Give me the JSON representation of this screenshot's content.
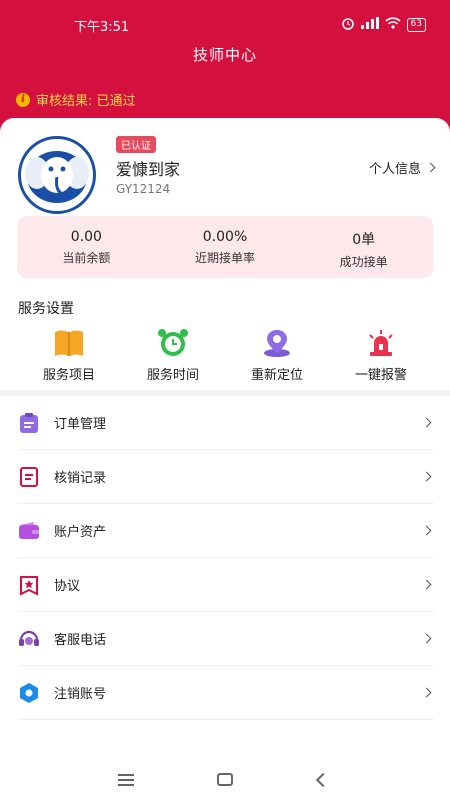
{
  "status_bar": {
    "time": "下午3:51",
    "battery": "63"
  },
  "header": {
    "title": "技师中心"
  },
  "review": {
    "text": "审核结果: 已通过"
  },
  "profile": {
    "badge": "已认证",
    "name": "爱慷到家",
    "id": "GY12124",
    "personal_info_label": "个人信息"
  },
  "stats": [
    {
      "value": "0.00",
      "label": "当前余额"
    },
    {
      "value": "0.00%",
      "label": "近期接单率"
    },
    {
      "value": "0单",
      "label": "成功接单"
    }
  ],
  "services": {
    "title": "服务设置",
    "items": [
      {
        "label": "服务项目",
        "icon": "book-icon",
        "color": "#f5a623"
      },
      {
        "label": "服务时间",
        "icon": "alarm-clock-icon",
        "color": "#2fbf4a"
      },
      {
        "label": "重新定位",
        "icon": "location-pin-icon",
        "color": "#7b5cd6"
      },
      {
        "label": "一键报警",
        "icon": "siren-icon",
        "color": "#e8324f"
      }
    ]
  },
  "menu": {
    "items": [
      {
        "label": "订单管理",
        "icon": "clipboard-icon",
        "color": "#8f6be8"
      },
      {
        "label": "核销记录",
        "icon": "document-icon",
        "color": "#d4103f"
      },
      {
        "label": "账户资产",
        "icon": "wallet-icon",
        "color": "#b44fe0"
      },
      {
        "label": "协议",
        "icon": "agreement-icon",
        "color": "#d4103f"
      },
      {
        "label": "客服电话",
        "icon": "headset-icon",
        "color": "#7b3fa8"
      },
      {
        "label": "注销账号",
        "icon": "hexagon-icon",
        "color": "#1a8be8"
      }
    ]
  },
  "colors": {
    "brand": "#d4103f",
    "review_text": "#ffd84a",
    "stats_bg": "#fde8ec"
  }
}
